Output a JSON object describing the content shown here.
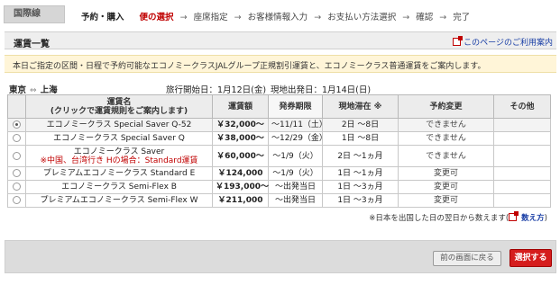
{
  "header": {
    "region_tab": "国際線",
    "steps": {
      "completed": "予約・購入",
      "current": "便の選択",
      "rest": [
        "座席指定",
        "お客様情報入力",
        "お支払い方法選択",
        "確認",
        "完了"
      ],
      "arrow": "→"
    }
  },
  "section": {
    "title": "運賃一覧",
    "guide_link": "このページのご利用案内"
  },
  "notice": "本日ご指定の区間・日程で予約可能なエコノミークラスJALグループ正規割引運賃と、エコノミークラス普通運賃をご案内します。",
  "route": {
    "from": "東京",
    "swap_icon": "⇔",
    "to": "上海",
    "departure": "旅行開始日：1月12日(金)",
    "return": "現地出発日：1月14日(日)"
  },
  "table": {
    "headers": {
      "fare_name": "運賃名",
      "fare_name_note": "(クリックで運賃規則をご案内します)",
      "fare_price": "運賃額",
      "ticketing": "発券期限",
      "stay": "現地滞在 ※",
      "change": "予約変更",
      "other": "その他"
    },
    "rows": [
      {
        "name": "エコノミークラス Special Saver Q-52",
        "warn": "",
        "price": "￥32,000～",
        "deadline": "～11/11（土）",
        "stay": "2日 ～8日",
        "change": "できません",
        "other": "",
        "selected": true
      },
      {
        "name": "エコノミークラス Special Saver Q",
        "warn": "",
        "price": "￥38,000～",
        "deadline": "～12/29（金）",
        "stay": "1日 ～8日",
        "change": "できません",
        "other": "",
        "selected": false
      },
      {
        "name": "エコノミークラス Saver",
        "warn": "※中国、台湾行き Hの場合：Standard運賃",
        "price": "￥60,000～",
        "deadline": "～1/9（火）",
        "stay": "2日 ～1ヵ月",
        "change": "できません",
        "other": "",
        "selected": false
      },
      {
        "name": "プレミアムエコノミークラス Standard E",
        "warn": "",
        "price": "￥124,000",
        "deadline": "～1/9（火）",
        "stay": "1日 ～1ヵ月",
        "change": "変更可",
        "other": "",
        "selected": false
      },
      {
        "name": "エコノミークラス Semi-Flex B",
        "warn": "",
        "price": "￥193,000～",
        "deadline": "～出発当日",
        "stay": "1日 ～3ヵ月",
        "change": "変更可",
        "other": "",
        "selected": false
      },
      {
        "name": "プレミアムエコノミークラス Semi-Flex W",
        "warn": "",
        "price": "￥211,000",
        "deadline": "～出発当日",
        "stay": "1日 ～3ヵ月",
        "change": "変更可",
        "other": "",
        "selected": false
      }
    ]
  },
  "footnote": {
    "text": "※日本を出国した日の翌日から数えます(",
    "link": "数え方",
    "close": ")"
  },
  "buttons": {
    "back": "前の画面に戻る",
    "select": "選択する"
  },
  "colors": {
    "accent_red": "#d51d1d",
    "link_blue": "#1a3fa6",
    "notice_bg": "#fff5d8"
  }
}
